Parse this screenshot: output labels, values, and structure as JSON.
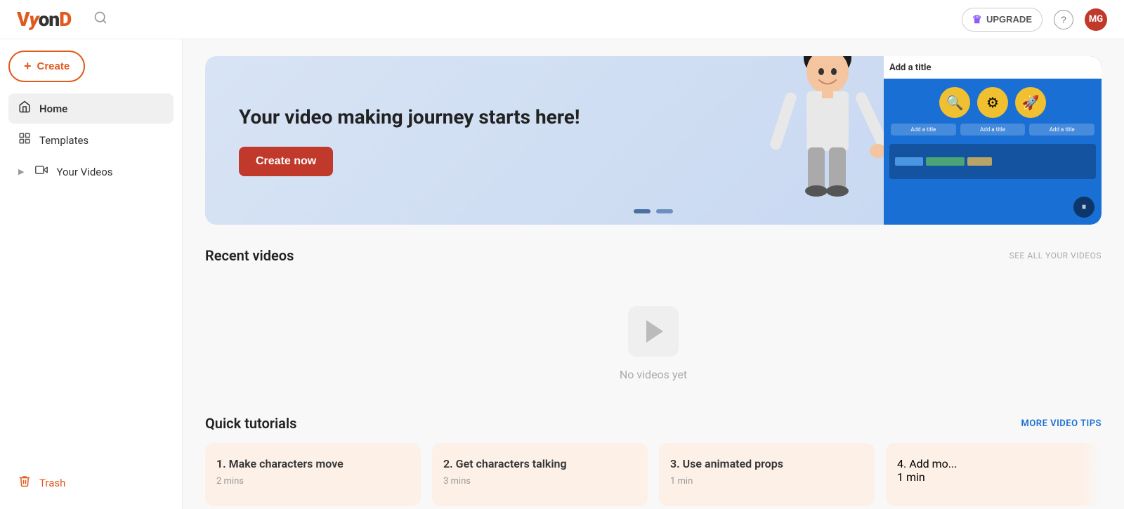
{
  "header": {
    "logo": "VYonD",
    "search_placeholder": "Search",
    "upgrade_label": "UPGRADE",
    "help_label": "?",
    "avatar_initials": "MG"
  },
  "sidebar": {
    "create_label": "+ Create",
    "nav_items": [
      {
        "id": "home",
        "label": "Home",
        "icon": "🏠",
        "active": true
      },
      {
        "id": "templates",
        "label": "Templates",
        "icon": "🖼"
      },
      {
        "id": "your-videos",
        "label": "Your Videos",
        "icon": "▷",
        "expandable": true
      }
    ],
    "trash_label": "Trash"
  },
  "hero": {
    "title": "Your video making journey starts here!",
    "cta_label": "Create now",
    "dots": [
      {
        "active": true
      },
      {
        "active": false
      }
    ],
    "editor_title": "Add a title",
    "slide_labels": [
      "Add a title",
      "Add a title",
      "Add a title"
    ]
  },
  "recent_videos": {
    "title": "Recent videos",
    "see_all_label": "SEE ALL YOUR VIDEOS",
    "empty_label": "No videos yet"
  },
  "tutorials": {
    "title": "Quick tutorials",
    "more_tips_label": "MORE VIDEO TIPS",
    "items": [
      {
        "number": "1",
        "title": "Make characters move",
        "duration": "2 mins"
      },
      {
        "number": "2",
        "title": "Get characters talking",
        "duration": "3 mins"
      },
      {
        "number": "3",
        "title": "Use animated props",
        "duration": "1 min"
      },
      {
        "number": "4",
        "title": "Add mo...",
        "duration": "1 min"
      }
    ]
  }
}
